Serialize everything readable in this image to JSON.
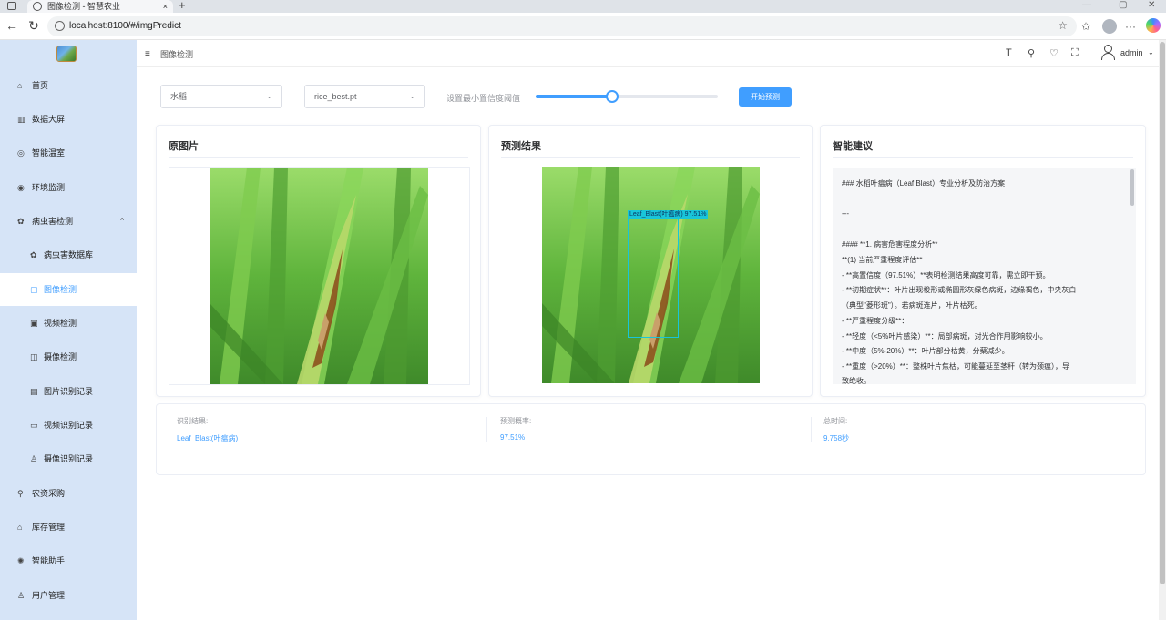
{
  "browser": {
    "tab_title": "图像检测 - 智慧农业",
    "tab_close": "×",
    "new_tab": "+",
    "url": "localhost:8100/#/imgPredict",
    "back": "←",
    "refresh": "↻",
    "win_min": "—",
    "win_max": "▢",
    "win_close": "✕",
    "star": "☆",
    "favorites": "✩",
    "more": "···"
  },
  "sidebar": {
    "items": [
      {
        "label": "首页",
        "icon": "⌂"
      },
      {
        "label": "数据大屏",
        "icon": "▥"
      },
      {
        "label": "智能温室",
        "icon": "◎"
      },
      {
        "label": "环境监测",
        "icon": "◉"
      },
      {
        "label": "病虫害检测",
        "icon": "✿",
        "chevron": "^"
      },
      {
        "label": "病虫害数据库",
        "icon": "✿"
      },
      {
        "label": "图像检测",
        "icon": "▢"
      },
      {
        "label": "视频检测",
        "icon": "▣"
      },
      {
        "label": "摄像检测",
        "icon": "◫"
      },
      {
        "label": "图片识别记录",
        "icon": "▤"
      },
      {
        "label": "视频识别记录",
        "icon": "▭"
      },
      {
        "label": "摄像识别记录",
        "icon": "♙"
      },
      {
        "label": "农资采购",
        "icon": "⚲"
      },
      {
        "label": "库存管理",
        "icon": "⌂"
      },
      {
        "label": "智能助手",
        "icon": "✺"
      },
      {
        "label": "用户管理",
        "icon": "♙"
      }
    ]
  },
  "header": {
    "breadcrumb": "图像检测",
    "hamburger": "≡",
    "icons": {
      "font": "T",
      "search": "⚲",
      "theme": "♡",
      "fullscreen": "⛶"
    },
    "username": "admin",
    "user_chev": "⌄"
  },
  "controls": {
    "crop_select": "水稻",
    "model_select": "rice_best.pt",
    "select_arrow": "⌄",
    "threshold_label": "设置最小置信度阈值",
    "threshold_value": 0.42,
    "start_button": "开始预测"
  },
  "cards": {
    "original_title": "原图片",
    "result_title": "预测结果",
    "advice_title": "智能建议",
    "detection_label": "Leaf_Blast(叶瘟病) 97.51%",
    "advice_lines": [
      "### 水稻叶瘟病（Leaf Blast）专业分析及防治方案",
      "---",
      "#### **1. 病害危害程度分析**",
      "**(1) 当前严重程度评估**",
      "- **高置信度（97.51%）**表明检测结果高度可靠，需立即干预。",
      "- **初期症状**：叶片出现梭形或椭圆形灰绿色病斑，边缘褐色，中央灰白",
      "（典型\"菱形斑\"）。若病斑连片，叶片枯死。",
      "- **严重程度分级**：",
      "  - **轻度（<5%叶片感染）**：局部病斑，对光合作用影响较小。",
      "  - **中度（5%-20%）**：叶片部分枯黄，分蘖减少。",
      "  - **重度（>20%）**：整株叶片焦枯，可能蔓延至茎秆（转为颈瘟），导",
      "致绝收。"
    ]
  },
  "result": {
    "label_class": "识别结果:",
    "value_class": "Leaf_Blast(叶瘟病)",
    "label_prob": "预测概率:",
    "value_prob": "97.51%",
    "label_time": "总时间:",
    "value_time": "9.758秒"
  }
}
